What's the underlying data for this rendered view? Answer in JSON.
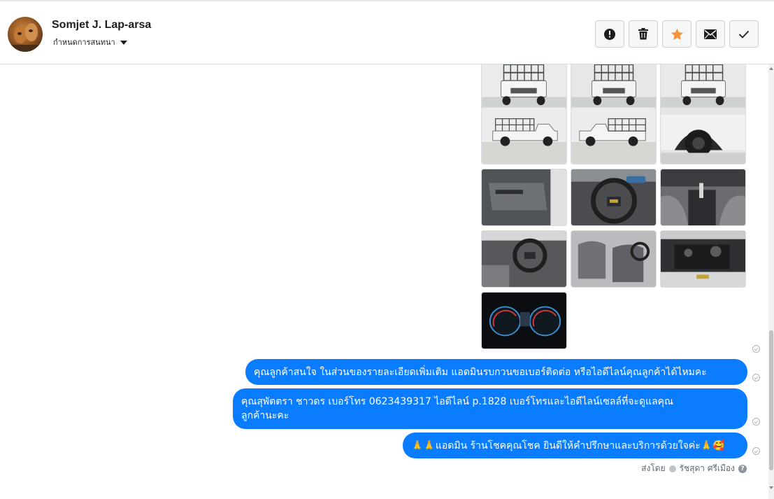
{
  "header": {
    "contact_name": "Somjet J. Lap-arsa",
    "assign_label": "กำหนดการสนทนา",
    "actions": [
      {
        "name": "report-spam",
        "icon": "exclamation-circle-icon"
      },
      {
        "name": "delete",
        "icon": "trash-icon"
      },
      {
        "name": "star",
        "icon": "star-icon",
        "color": "#f7923b"
      },
      {
        "name": "mark-unread",
        "icon": "envelope-icon"
      },
      {
        "name": "mark-done",
        "icon": "check-icon"
      }
    ]
  },
  "thread": {
    "photos": [
      {
        "subject": "pickup-rear-cage"
      },
      {
        "subject": "pickup-rear-cage"
      },
      {
        "subject": "pickup-rear-cage"
      },
      {
        "subject": "pickup-side-cage"
      },
      {
        "subject": "pickup-side-cage"
      },
      {
        "subject": "rear-wheel"
      },
      {
        "subject": "door-interior"
      },
      {
        "subject": "steering-wheel"
      },
      {
        "subject": "gear-console"
      },
      {
        "subject": "dashboard"
      },
      {
        "subject": "seats"
      },
      {
        "subject": "engine-bay"
      },
      {
        "subject": "gauge-cluster"
      }
    ],
    "messages": [
      {
        "text": "คุณลูกค้าสนใจ ในส่วนของรายละเอียดเพิ่มเติม แอดมินรบกวนขอเบอร์ติดต่อ หรือไอดีไลน์คุณลูกค้าได้ไหมคะ"
      },
      {
        "text_line1": "คุณสุพัตตรา   ชาวดร      เบอร์โทร 0623439317  ไอดีไลน์ p.1828  เบอร์โทรและไอดีไลน์เซลล์ที่จะดูแลคุณ",
        "text_line2": "ลูกค้านะคะ"
      },
      {
        "text": "🙏🙏แอดมิน ร้านโชคคุณโชค ยินดีให้คำปรึกษาและบริการด้วยใจค่ะ🙏🥰"
      }
    ],
    "sent_by_label": "ส่งโดย",
    "sent_by_name": "รัชสุดา ศรีเมือง",
    "bubble_color": "#0a7cff"
  }
}
